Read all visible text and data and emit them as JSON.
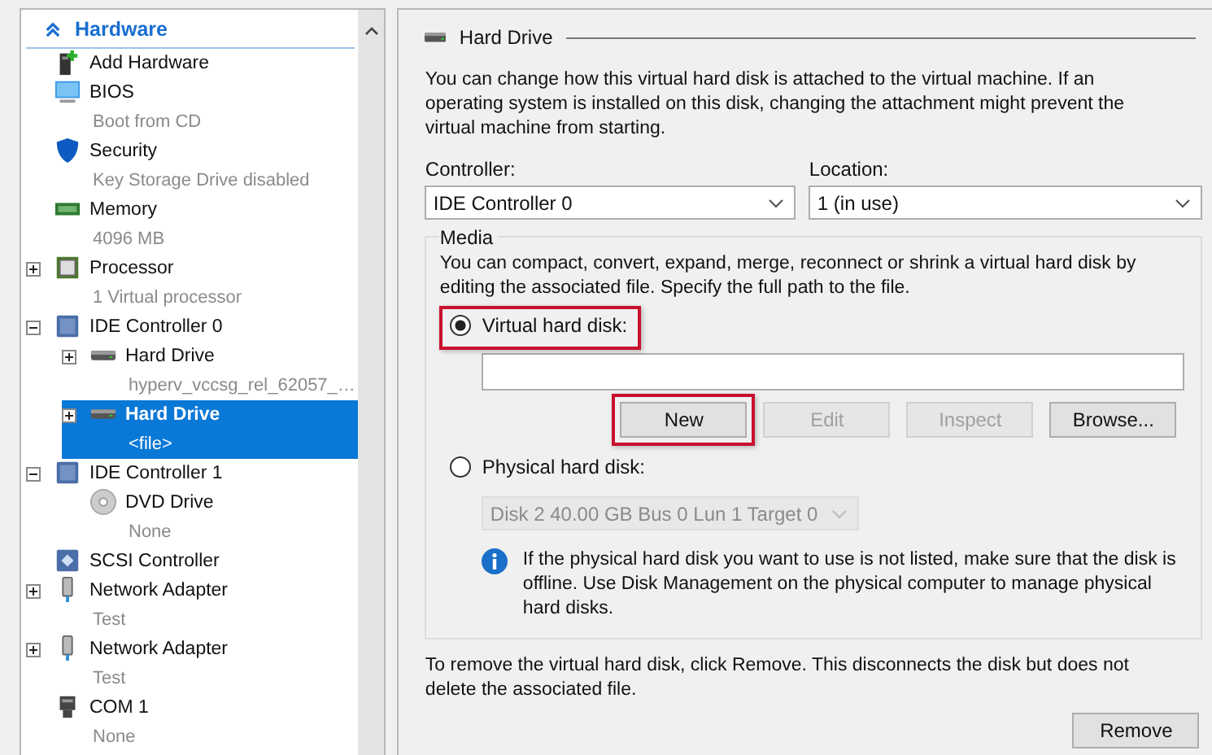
{
  "hardware": {
    "title": "Hardware",
    "items": [
      {
        "kind": "add-hardware",
        "label": "Add Hardware",
        "selected": false
      },
      {
        "kind": "bios",
        "label": "BIOS",
        "detail": "Boot from CD",
        "selected": false
      },
      {
        "kind": "security",
        "label": "Security",
        "detail": "Key Storage Drive disabled",
        "selected": false
      },
      {
        "kind": "memory",
        "label": "Memory",
        "detail": "4096 MB",
        "selected": false
      },
      {
        "kind": "processor",
        "label": "Processor",
        "detail": "1 Virtual processor",
        "expanded": false,
        "selected": false
      },
      {
        "kind": "controller",
        "label": "IDE Controller 0",
        "expanded": true,
        "selected": false,
        "children": [
          {
            "kind": "hard-drive",
            "label": "Hard Drive",
            "detail": "hyperv_vccsg_rel_62057_…",
            "expanded": false,
            "selected": false
          },
          {
            "kind": "hard-drive",
            "label": "Hard Drive",
            "detail": "<file>",
            "expanded": false,
            "selected": true
          }
        ]
      },
      {
        "kind": "controller",
        "label": "IDE Controller 1",
        "expanded": true,
        "selected": false,
        "children": [
          {
            "kind": "dvd",
            "label": "DVD Drive",
            "detail": "None",
            "selected": false
          }
        ]
      },
      {
        "kind": "scsi",
        "label": "SCSI Controller",
        "selected": false
      },
      {
        "kind": "network",
        "label": "Network Adapter",
        "detail": "Test",
        "expanded": false,
        "selected": false
      },
      {
        "kind": "network",
        "label": "Network Adapter",
        "detail": "Test",
        "expanded": false,
        "selected": false
      },
      {
        "kind": "com",
        "label": "COM 1",
        "detail": "None",
        "selected": false
      }
    ]
  },
  "details": {
    "title": "Hard Drive",
    "description": "You can change how this virtual hard disk is attached to the virtual machine. If an operating system is installed on this disk, changing the attachment might prevent the virtual machine from starting.",
    "fields": [
      {
        "label": "Controller:",
        "value": "IDE Controller 0"
      },
      {
        "label": "Location:",
        "value": "1 (in use)"
      }
    ],
    "media": {
      "title": "Media",
      "description": "You can compact, convert, expand, merge, reconnect or shrink a virtual hard disk by editing the associated file. Specify the full path to the file.",
      "virtual_disk": {
        "label": "Virtual hard disk:",
        "selected": true,
        "highlighted": true
      },
      "buttons": [
        {
          "label": "New",
          "disabled": false,
          "highlighted": true
        },
        {
          "label": "Edit",
          "disabled": true,
          "highlighted": false
        },
        {
          "label": "Inspect",
          "disabled": true,
          "highlighted": false
        },
        {
          "label": "Browse...",
          "disabled": false,
          "highlighted": false
        }
      ],
      "physical_disk": {
        "label": "Physical hard disk:",
        "selected": false
      },
      "disk_select": {
        "value": "Disk 2 40.00 GB Bus 0 Lun 1 Target 0",
        "disabled": true
      },
      "note": "If the physical hard disk you want to use is not listed, make sure that the disk is offline. Use Disk Management on the physical computer to manage physical hard disks."
    },
    "remove_note": "To remove the virtual hard disk, click Remove. This disconnects the disk but does not delete the associated file.",
    "remove_button": "Remove"
  }
}
